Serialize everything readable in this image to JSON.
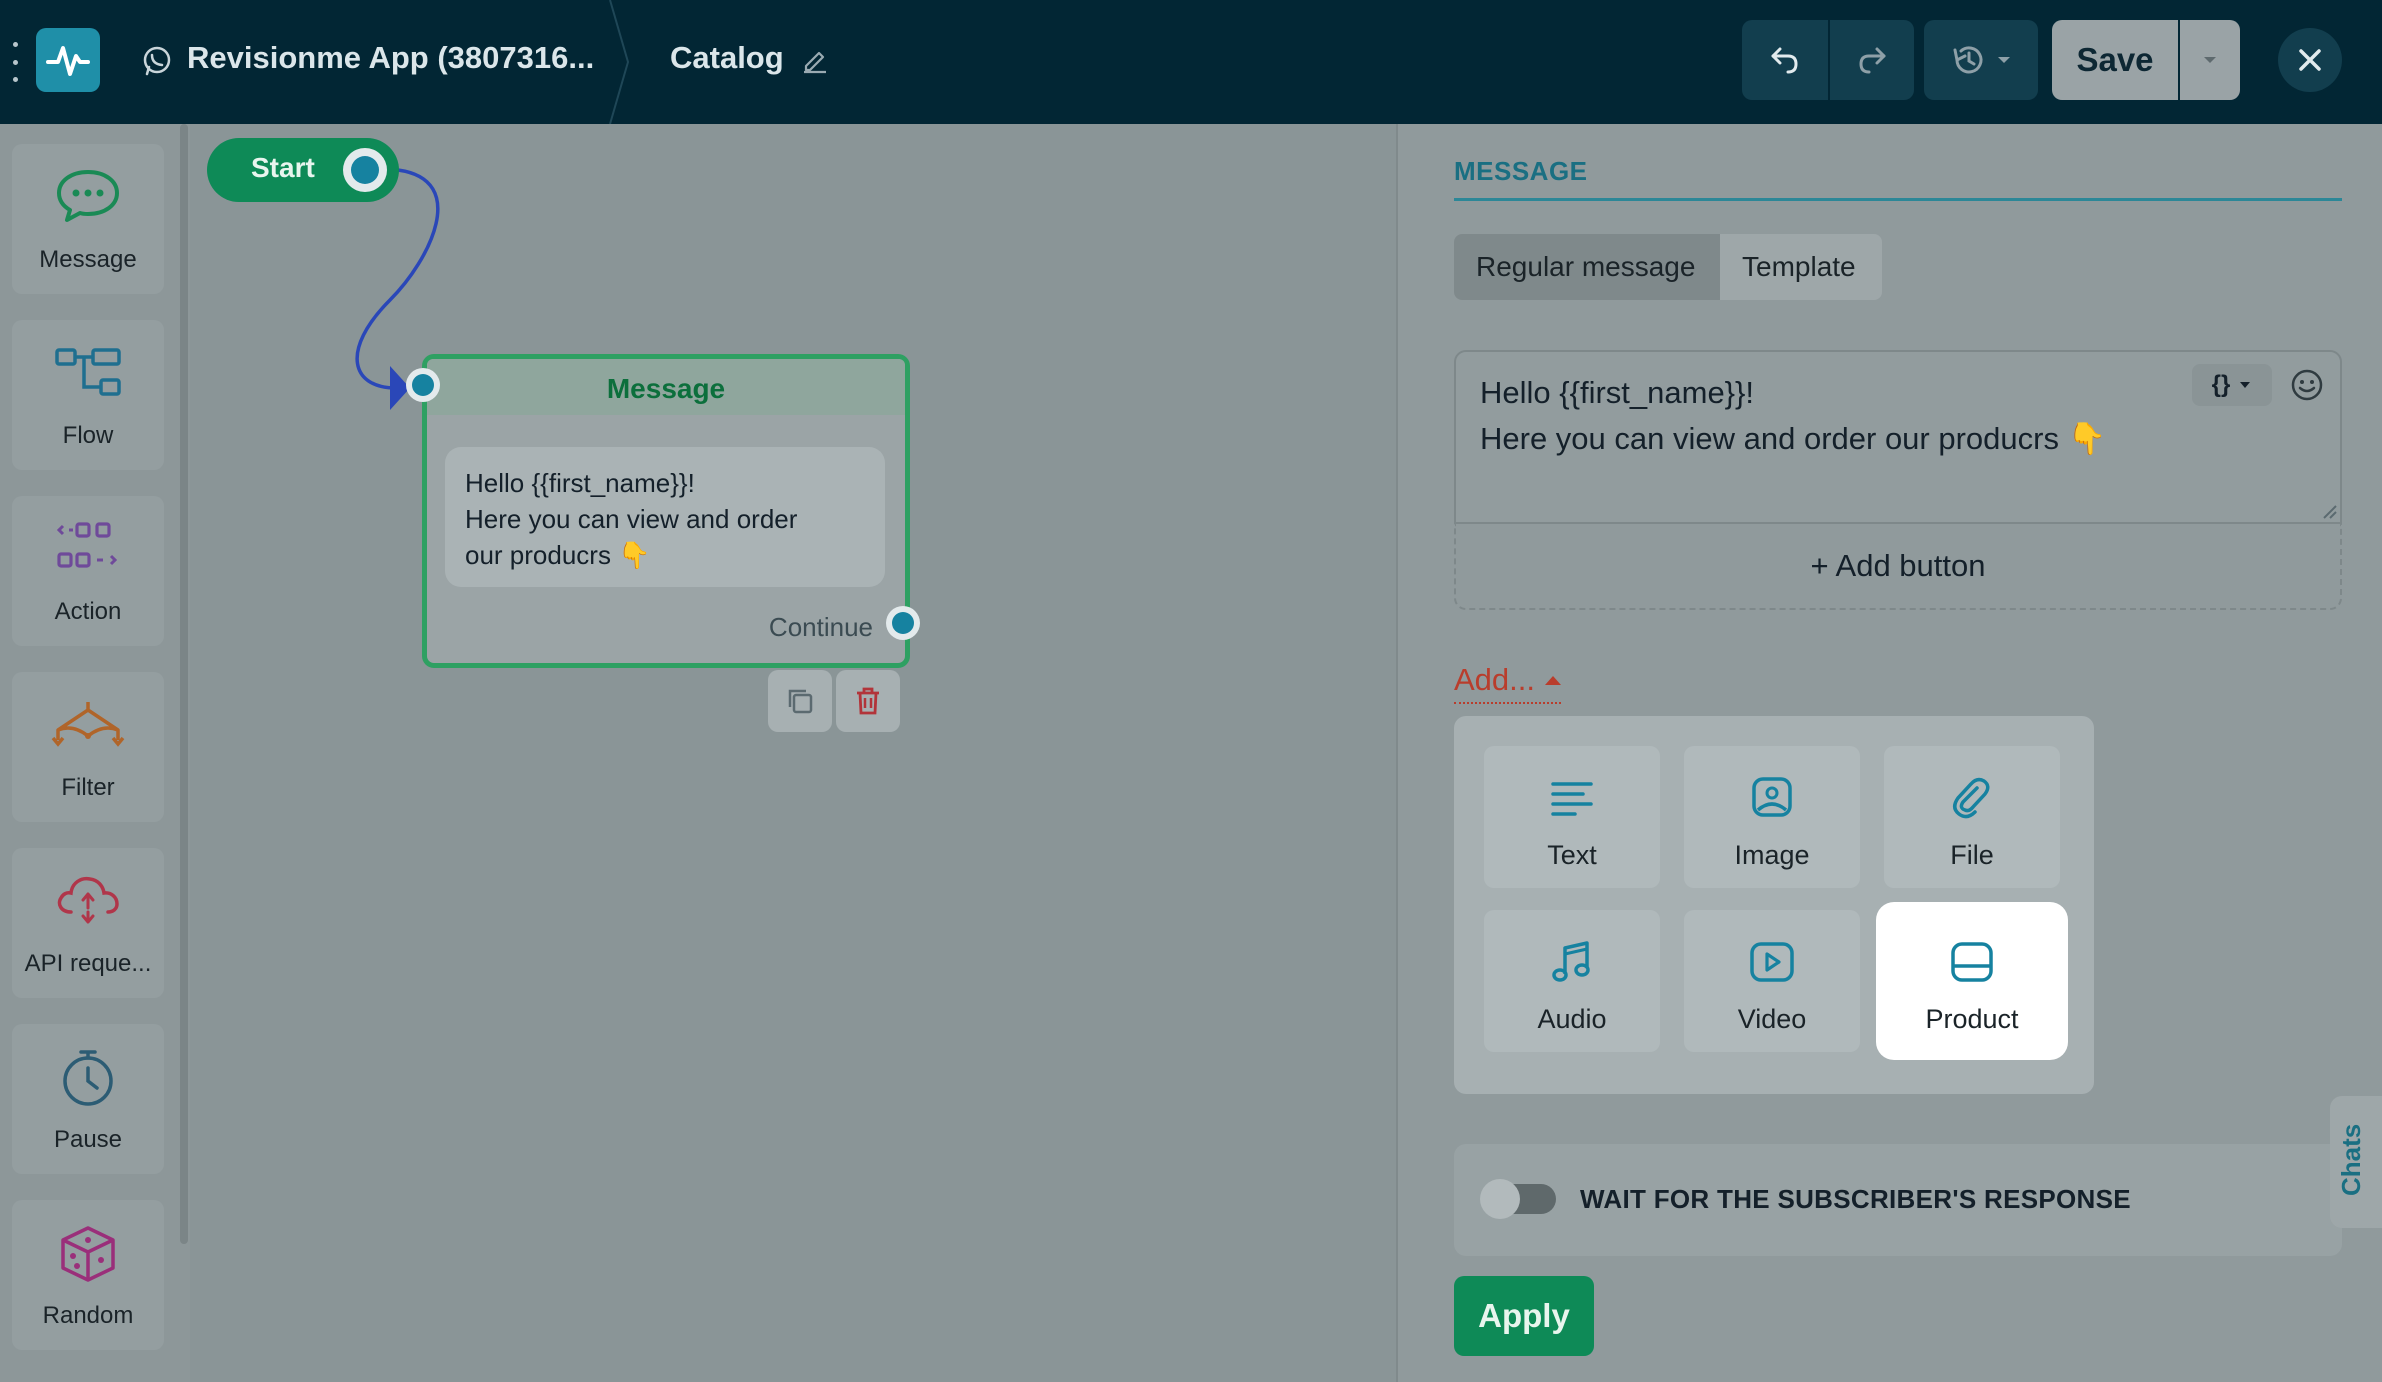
{
  "header": {
    "app_name": "Revisionme App (3807316...",
    "flow_name": "Catalog",
    "save_label": "Save"
  },
  "sidebar": {
    "items": [
      {
        "label": "Message",
        "icon": "message-icon"
      },
      {
        "label": "Flow",
        "icon": "flow-icon"
      },
      {
        "label": "Action",
        "icon": "action-icon"
      },
      {
        "label": "Filter",
        "icon": "filter-icon"
      },
      {
        "label": "API reque...",
        "icon": "cloud-icon"
      },
      {
        "label": "Pause",
        "icon": "clock-icon"
      },
      {
        "label": "Random",
        "icon": "dice-icon"
      }
    ]
  },
  "canvas": {
    "start_label": "Start",
    "message_node": {
      "title": "Message",
      "body_line1": "Hello {{first_name}}!",
      "body_line2": "Here you can view and order",
      "body_line3": "our producrs 👇",
      "continue_label": "Continue"
    }
  },
  "panel": {
    "heading": "MESSAGE",
    "tabs": {
      "regular": "Regular message",
      "template": "Template"
    },
    "message_text": "Hello {{first_name}}!\nHere you can view and order our producrs 👇",
    "variables_label": "{}",
    "add_button_label": "+ Add button",
    "add_label": "Add...",
    "add_menu": [
      {
        "label": "Text",
        "icon": "text-icon"
      },
      {
        "label": "Image",
        "icon": "image-icon"
      },
      {
        "label": "File",
        "icon": "paperclip-icon"
      },
      {
        "label": "Audio",
        "icon": "music-icon"
      },
      {
        "label": "Video",
        "icon": "video-icon"
      },
      {
        "label": "Product",
        "icon": "product-icon"
      }
    ],
    "wait_label": "WAIT FOR THE SUBSCRIBER'S RESPONSE",
    "apply_label": "Apply"
  },
  "chats_label": "Chats",
  "colors": {
    "topbar": "#022634",
    "accent_green": "#0e8a57",
    "accent_teal": "#1682a0",
    "add_red": "#b93d2c"
  }
}
